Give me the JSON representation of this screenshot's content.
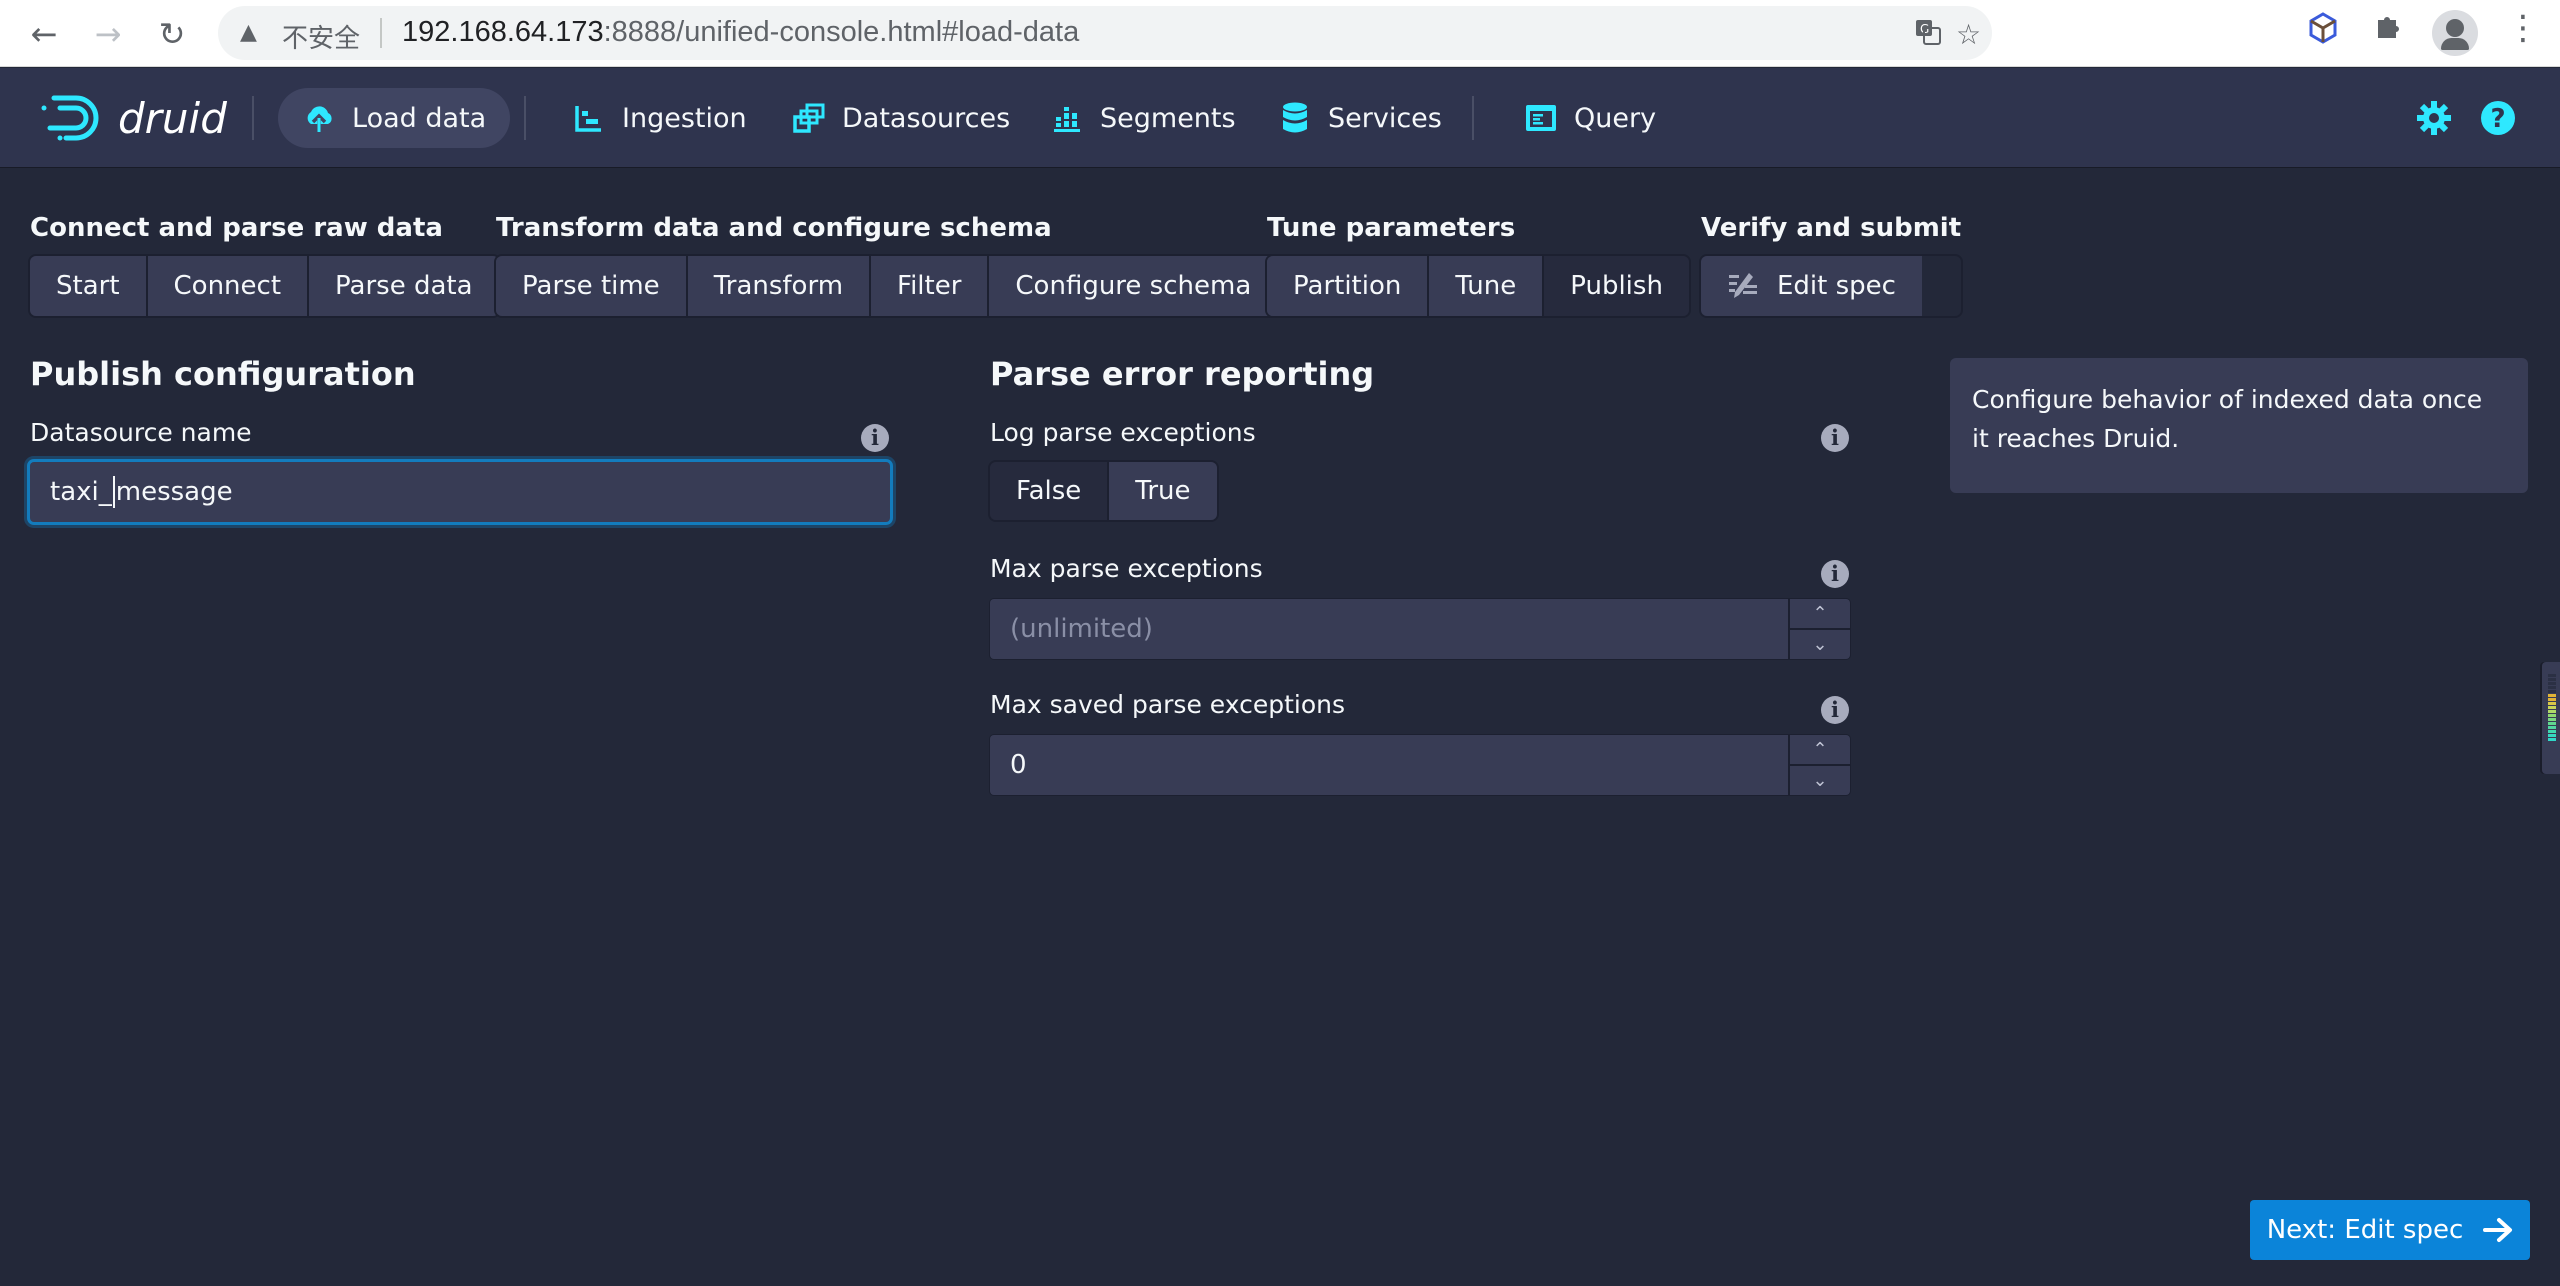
{
  "browser": {
    "security_label": "不安全",
    "url_host": "192.168.64.173",
    "url_rest": ":8888/unified-console.html#load-data"
  },
  "nav": {
    "logo_text": "druid",
    "items": [
      {
        "label": "Load data",
        "icon": "cloud-upload-icon",
        "active": true
      },
      {
        "label": "Ingestion",
        "icon": "gantt-chart-icon",
        "active": false
      },
      {
        "label": "Datasources",
        "icon": "multi-select-icon",
        "active": false
      },
      {
        "label": "Segments",
        "icon": "stacked-chart-icon",
        "active": false
      },
      {
        "label": "Services",
        "icon": "database-icon",
        "active": false
      },
      {
        "label": "Query",
        "icon": "application-icon",
        "active": false
      }
    ],
    "right_icons": [
      "gear-icon",
      "help-icon"
    ],
    "accent_color": "#2ee8ff"
  },
  "steps": [
    {
      "title": "Connect and parse raw data",
      "buttons": [
        "Start",
        "Connect",
        "Parse data"
      ]
    },
    {
      "title": "Transform data and configure schema",
      "buttons": [
        "Parse time",
        "Transform",
        "Filter",
        "Configure schema"
      ]
    },
    {
      "title": "Tune parameters",
      "buttons": [
        "Partition",
        "Tune",
        "Publish"
      ],
      "active": "Publish"
    },
    {
      "title": "Verify and submit",
      "buttons": [
        "Edit spec"
      ]
    }
  ],
  "publish": {
    "title": "Publish configuration",
    "datasource_label": "Datasource name",
    "datasource_value_before_caret": "taxi_",
    "datasource_value_after_caret": "message"
  },
  "parse_errors": {
    "title": "Parse error reporting",
    "log_label": "Log parse exceptions",
    "log_options": [
      "False",
      "True"
    ],
    "log_selected": "False",
    "max_label": "Max parse exceptions",
    "max_placeholder": "(unlimited)",
    "max_value": "",
    "max_saved_label": "Max saved parse exceptions",
    "max_saved_value": "0"
  },
  "info_panel": {
    "text": "Configure behavior of indexed data once it reaches Druid."
  },
  "next_button": {
    "label": "Next: Edit spec",
    "color": "#0b84d9"
  }
}
